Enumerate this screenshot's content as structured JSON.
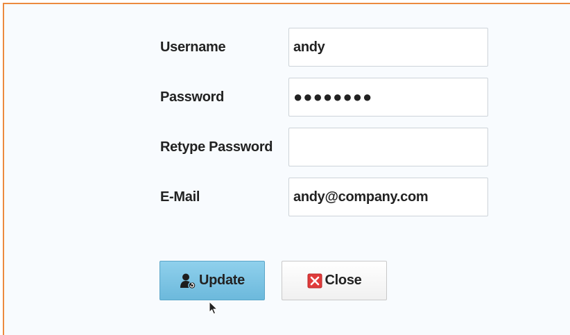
{
  "form": {
    "username": {
      "label": "Username",
      "value": "andy"
    },
    "password": {
      "label": "Password",
      "value": "●●●●●●●●"
    },
    "retype_password": {
      "label": "Retype Password",
      "value": ""
    },
    "email": {
      "label": "E-Mail",
      "value": "andy@company.com"
    }
  },
  "buttons": {
    "update": {
      "label": "Update",
      "icon": "user-update-icon"
    },
    "close": {
      "label": "Close",
      "icon": "close-icon"
    }
  },
  "colors": {
    "accent_border": "#ec8a3f",
    "update_button": "#7cc5e4",
    "close_icon": "#e03b3b"
  }
}
